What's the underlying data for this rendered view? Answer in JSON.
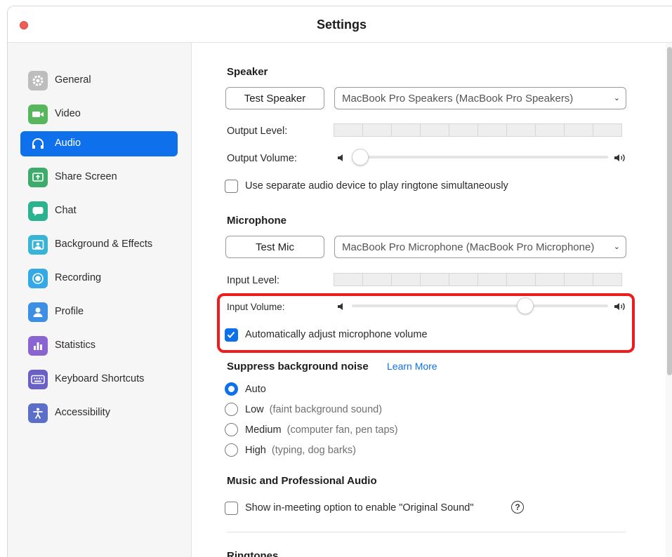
{
  "window": {
    "title": "Settings"
  },
  "colors": {
    "accent": "#0e71eb",
    "highlight": "#ee1c1c",
    "close": "#ee5f57"
  },
  "sidebar": {
    "items": [
      {
        "label": "General",
        "icon": "gear-icon",
        "color": "#bdbdbd"
      },
      {
        "label": "Video",
        "icon": "video-camera-icon",
        "color": "#58b65c"
      },
      {
        "label": "Audio",
        "icon": "headphones-icon",
        "color": "#0e71eb",
        "active": true
      },
      {
        "label": "Share Screen",
        "icon": "share-screen-icon",
        "color": "#3cab6b"
      },
      {
        "label": "Chat",
        "icon": "chat-bubble-icon",
        "color": "#2ab38e"
      },
      {
        "label": "Background & Effects",
        "icon": "background-icon",
        "color": "#3ab4d6"
      },
      {
        "label": "Recording",
        "icon": "record-icon",
        "color": "#35a8e6"
      },
      {
        "label": "Profile",
        "icon": "profile-icon",
        "color": "#3d8fe6"
      },
      {
        "label": "Statistics",
        "icon": "statistics-icon",
        "color": "#8a65d1"
      },
      {
        "label": "Keyboard Shortcuts",
        "icon": "keyboard-icon",
        "color": "#6a5fc6"
      },
      {
        "label": "Accessibility",
        "icon": "accessibility-icon",
        "color": "#5b6fc9"
      }
    ]
  },
  "speaker": {
    "title": "Speaker",
    "test_button": "Test Speaker",
    "device": "MacBook Pro Speakers (MacBook Pro Speakers)",
    "output_level_label": "Output Level:",
    "output_volume_label": "Output Volume:",
    "output_volume_fraction": 0.0,
    "separate_device_label": "Use separate audio device to play ringtone simultaneously",
    "separate_device_checked": false
  },
  "microphone": {
    "title": "Microphone",
    "test_button": "Test Mic",
    "device": "MacBook Pro Microphone (MacBook Pro Microphone)",
    "input_level_label": "Input Level:",
    "input_volume_label": "Input Volume:",
    "input_volume_fraction": 0.69,
    "auto_adjust_label": "Automatically adjust microphone volume",
    "auto_adjust_checked": true
  },
  "noise": {
    "title": "Suppress background noise",
    "learn_more": "Learn More",
    "options": [
      {
        "label": "Auto",
        "hint": "",
        "checked": true
      },
      {
        "label": "Low",
        "hint": "(faint background sound)",
        "checked": false
      },
      {
        "label": "Medium",
        "hint": "(computer fan, pen taps)",
        "checked": false
      },
      {
        "label": "High",
        "hint": "(typing, dog barks)",
        "checked": false
      }
    ]
  },
  "music": {
    "title": "Music and Professional Audio",
    "original_sound_label": "Show in-meeting option to enable \"Original Sound\"",
    "original_sound_checked": false
  },
  "ringtones": {
    "title": "Ringtones"
  }
}
